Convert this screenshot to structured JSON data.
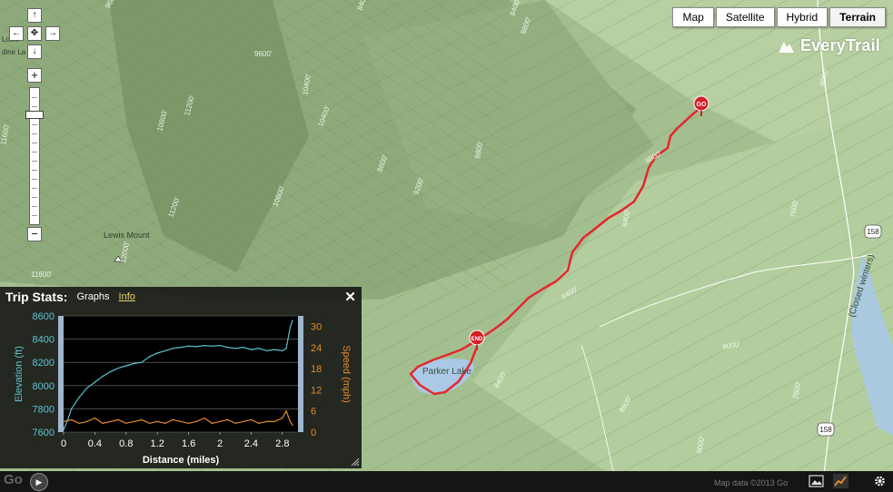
{
  "map_types": [
    {
      "label": "Map",
      "active": false
    },
    {
      "label": "Satellite",
      "active": false
    },
    {
      "label": "Hybrid",
      "active": false
    },
    {
      "label": "Terrain",
      "active": true
    }
  ],
  "brand": "EveryTrail",
  "nav": {
    "zoom_in": "+",
    "zoom_out": "−"
  },
  "map_labels": {
    "lake": "Parker Lake",
    "peak": "Lewis Mount",
    "road": "(Closed winters)",
    "route_158a": "158",
    "route_158b": "158",
    "marker_start": "GO",
    "marker_end": "END",
    "contours": [
      "9600'",
      "8800'",
      "8400'",
      "9600'",
      "10400'",
      "10400'",
      "11600'",
      "11200'",
      "10800'",
      "8800'",
      "9200'",
      "8000'",
      "8400'",
      "8800'",
      "8400'",
      "11200'",
      "12000'",
      "10800'",
      "8800'",
      "8000'",
      "7600'",
      "8000'",
      "8800'",
      "11600'",
      "8400'",
      "9600'",
      "7600'",
      "8000'",
      "8400'"
    ],
    "edge_a": "Lowe",
    "edge_b": "dine La"
  },
  "trip_stats": {
    "title": "Trip Stats:",
    "tabs": [
      "Graphs",
      "Info"
    ],
    "close": "✕"
  },
  "chart_data": {
    "type": "line",
    "xlabel": "Distance (miles)",
    "ylabel": "Elevation (ft)",
    "y2label": "Speed (mph)",
    "xlim": [
      0,
      3.0
    ],
    "xticks": [
      "0",
      "0.4",
      "0.8",
      "1.2",
      "1.6",
      "2",
      "2.4",
      "2.8"
    ],
    "ylim": [
      7600,
      8600
    ],
    "yticks": [
      "8600",
      "8400",
      "8200",
      "8000",
      "7800",
      "7600"
    ],
    "y2lim": [
      0,
      33
    ],
    "y2ticks": [
      "30",
      "24",
      "18",
      "12",
      "6",
      "0"
    ],
    "series": [
      {
        "name": "Elevation",
        "axis": "left",
        "color": "#59c1cf",
        "x": [
          0,
          0.05,
          0.1,
          0.2,
          0.3,
          0.4,
          0.5,
          0.6,
          0.7,
          0.8,
          0.9,
          1.0,
          1.1,
          1.2,
          1.3,
          1.4,
          1.5,
          1.6,
          1.7,
          1.8,
          1.9,
          2.0,
          2.1,
          2.2,
          2.3,
          2.4,
          2.5,
          2.6,
          2.7,
          2.8,
          2.85,
          2.9,
          2.93
        ],
        "y": [
          7620,
          7700,
          7800,
          7900,
          7980,
          8030,
          8080,
          8120,
          8150,
          8170,
          8190,
          8200,
          8250,
          8280,
          8300,
          8320,
          8330,
          8340,
          8335,
          8345,
          8340,
          8345,
          8330,
          8320,
          8330,
          8310,
          8320,
          8300,
          8310,
          8300,
          8320,
          8500,
          8560
        ]
      },
      {
        "name": "Speed",
        "axis": "right",
        "color": "#e38a2b",
        "x": [
          0,
          0.1,
          0.2,
          0.3,
          0.4,
          0.5,
          0.6,
          0.7,
          0.8,
          0.9,
          1.0,
          1.1,
          1.2,
          1.3,
          1.4,
          1.5,
          1.6,
          1.7,
          1.8,
          1.9,
          2.0,
          2.1,
          2.2,
          2.3,
          2.4,
          2.5,
          2.6,
          2.7,
          2.8,
          2.85,
          2.9,
          2.93
        ],
        "y": [
          3,
          3.5,
          2.5,
          3,
          4,
          2.5,
          3,
          3.5,
          2.5,
          3,
          3.5,
          2.5,
          3,
          2.5,
          3.5,
          3,
          2.5,
          3,
          4,
          2.5,
          3,
          3.5,
          2.5,
          3,
          3.5,
          2.5,
          3,
          3,
          4,
          6,
          3,
          2
        ]
      }
    ]
  },
  "bottom": {
    "google": "Go",
    "attribution": "Map data ©2013 Go"
  }
}
